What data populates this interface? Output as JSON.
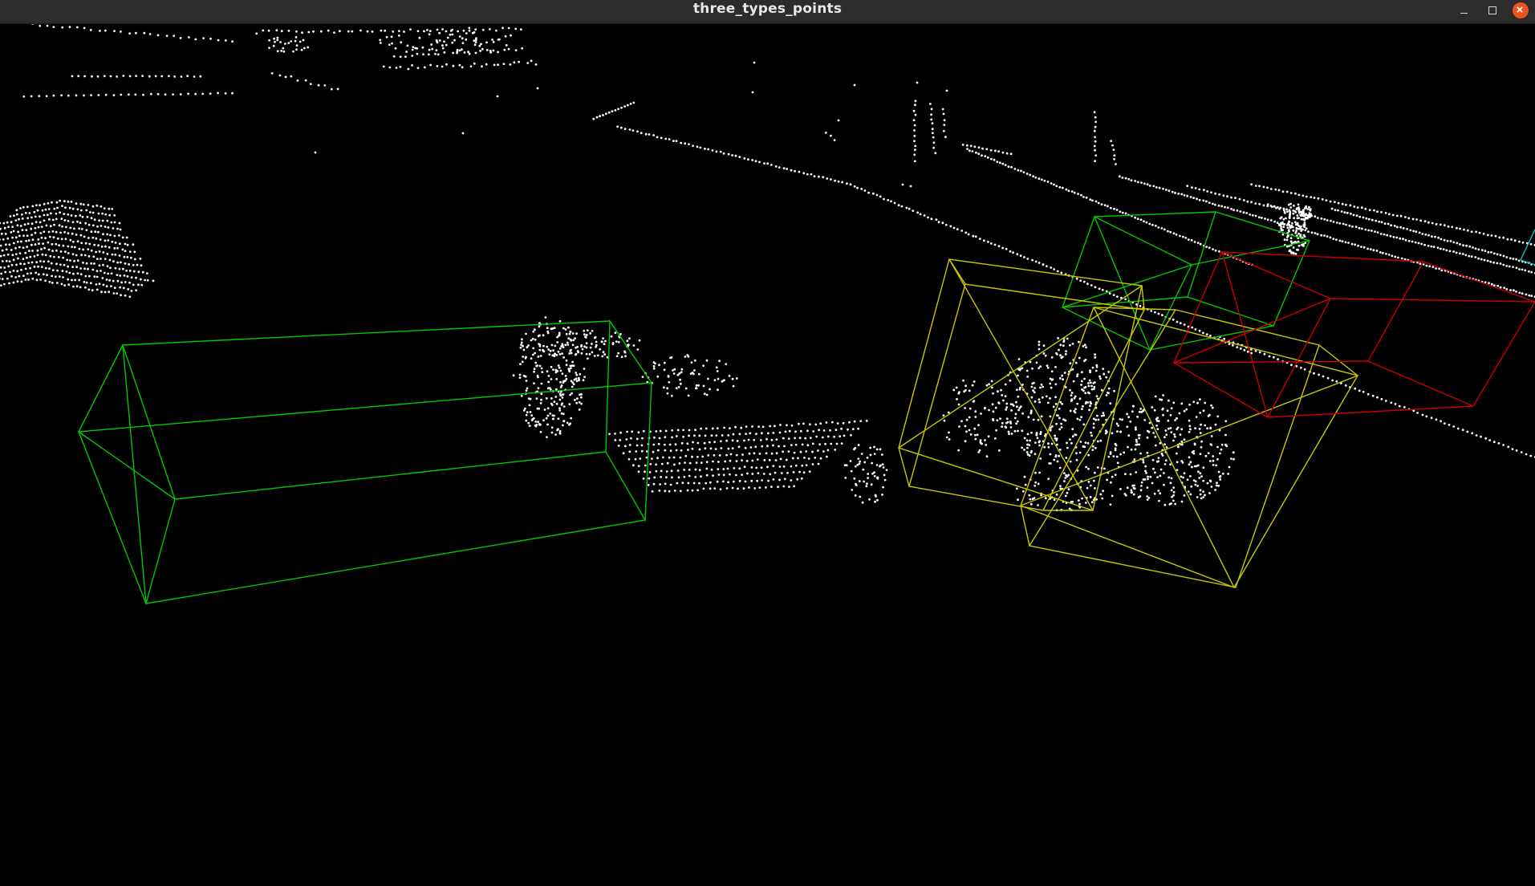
{
  "window": {
    "title": "three_types_points"
  },
  "titlebar_buttons": {
    "minimize_icon": "minimize-icon",
    "maximize_icon": "maximize-icon",
    "close_icon": "close-icon"
  },
  "viewport": {
    "background": "#000000",
    "point_color": "#ffffff",
    "box_colors": {
      "green": "#00c800",
      "yellow": "#c8c800",
      "red": "#c80000",
      "cyan": "#00c8c8"
    }
  }
}
